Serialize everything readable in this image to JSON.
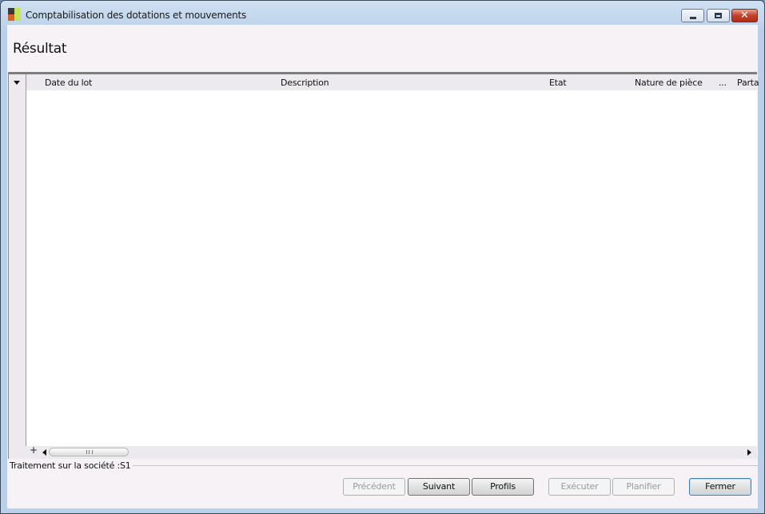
{
  "window": {
    "title": "Comptabilisation des dotations et mouvements",
    "close_glyph": "✕"
  },
  "page": {
    "heading": "Résultat"
  },
  "grid": {
    "columns": [
      "Date du lot",
      "Description",
      "Etat",
      "Nature de pièce",
      "...",
      "Parta"
    ],
    "rows": [],
    "add_glyph": "+"
  },
  "status": {
    "text": "Traitement sur la société :S1"
  },
  "buttons": {
    "previous": "Précédent",
    "next": "Suivant",
    "profiles": "Profils",
    "execute": "Exécuter",
    "schedule": "Planifier",
    "close": "Fermer"
  },
  "colors": {
    "title_gradient_top": "#cfe0f2",
    "client_background": "#f6f2f6",
    "close_button": "#c2402a"
  },
  "icons": {
    "app": "app-icon",
    "minimize": "minimize-icon",
    "maximize": "maximize-icon",
    "close": "close-icon",
    "column_menu": "chevron-down-icon",
    "scroll_left": "arrow-left-icon",
    "scroll_right": "arrow-right-icon"
  }
}
